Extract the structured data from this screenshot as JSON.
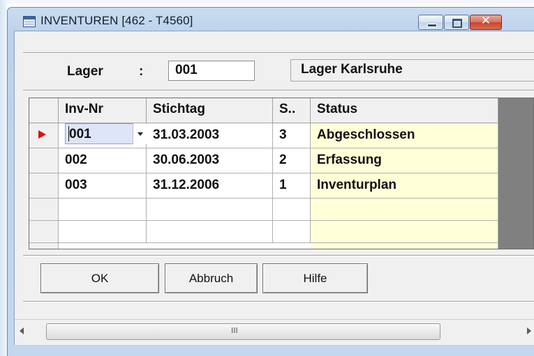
{
  "window": {
    "title": "INVENTUREN  [462 - T4560]",
    "caption_buttons": [
      "minimize",
      "maximize",
      "close"
    ],
    "close_glyph": "✕"
  },
  "lager": {
    "label": "Lager",
    "colon": ":",
    "value": "001",
    "name": "Lager Karlsruhe"
  },
  "grid": {
    "columns": [
      "Inv-Nr",
      "Stichtag",
      "S..",
      "Status"
    ],
    "rows": [
      {
        "inv_nr": "001",
        "stichtag": "31.03.2003",
        "s": "3",
        "status": "Abgeschlossen"
      },
      {
        "inv_nr": "002",
        "stichtag": "30.06.2003",
        "s": "2",
        "status": "Erfassung"
      },
      {
        "inv_nr": "003",
        "stichtag": "31.12.2006",
        "s": "1",
        "status": "Inventurplan"
      }
    ],
    "current_row_indicator": "red-triangle-icon"
  },
  "buttons": {
    "ok": "OK",
    "cancel": "Abbruch",
    "help": "Hilfe"
  },
  "scrollbar": {
    "grip": "III"
  },
  "colors": {
    "status_background": "#ffffd8",
    "indicator_arrow": "#e01010",
    "close_button": "#c8452f"
  }
}
